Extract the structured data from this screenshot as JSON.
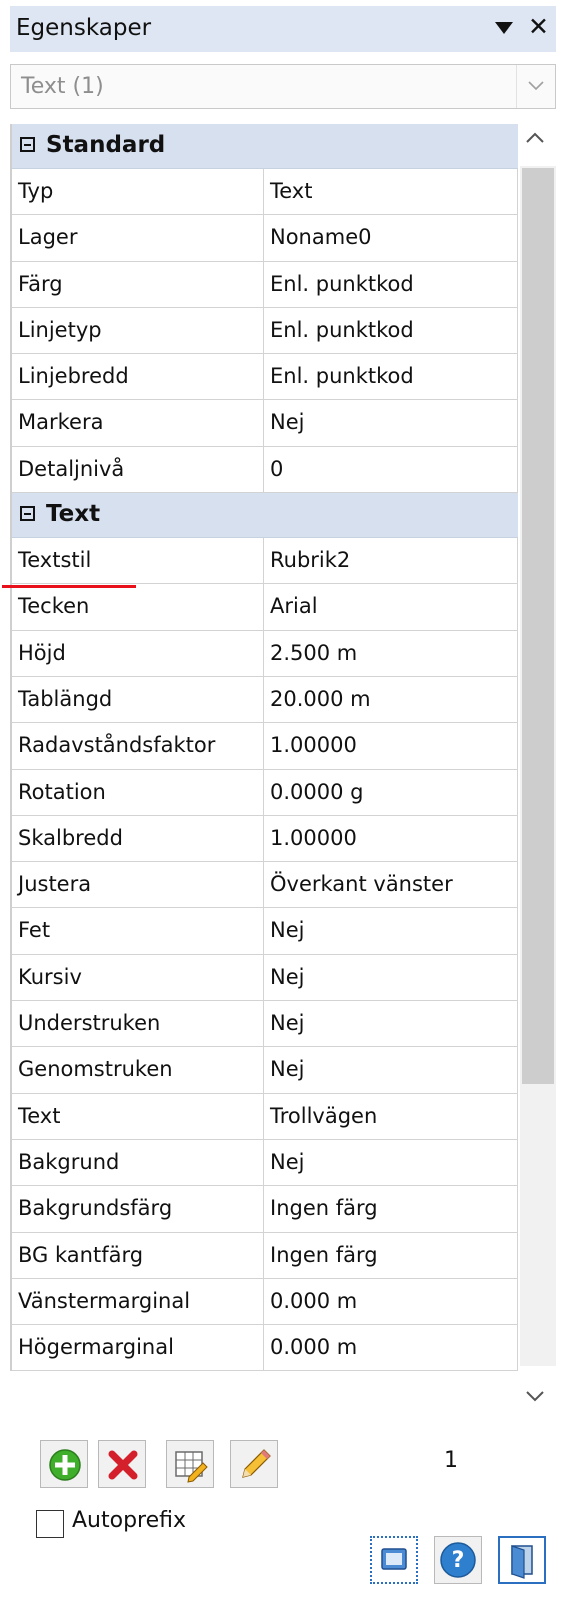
{
  "panel": {
    "title": "Egenskaper",
    "pin_icon": "dropdown-arrow-icon",
    "close_glyph": "✕"
  },
  "selector": {
    "value": "Text (1)"
  },
  "sections": [
    {
      "label": "Standard",
      "rows": [
        {
          "name": "Typ",
          "value": "Text"
        },
        {
          "name": "Lager",
          "value": "Noname0"
        },
        {
          "name": "Färg",
          "value": "Enl. punktkod"
        },
        {
          "name": "Linjetyp",
          "value": "Enl. punktkod"
        },
        {
          "name": "Linjebredd",
          "value": "Enl. punktkod"
        },
        {
          "name": "Markera",
          "value": "Nej"
        },
        {
          "name": "Detaljnivå",
          "value": "0"
        }
      ]
    },
    {
      "label": "Text",
      "rows": [
        {
          "name": "Textstil",
          "value": "Rubrik2"
        },
        {
          "name": "Tecken",
          "value": "Arial"
        },
        {
          "name": "Höjd",
          "value": "2.500 m"
        },
        {
          "name": "Tablängd",
          "value": "20.000 m"
        },
        {
          "name": "Radavståndsfaktor",
          "value": "1.00000"
        },
        {
          "name": "Rotation",
          "value": "0.0000 g"
        },
        {
          "name": "Skalbredd",
          "value": "1.00000"
        },
        {
          "name": "Justera",
          "value": "Överkant vänster"
        },
        {
          "name": "Fet",
          "value": "Nej"
        },
        {
          "name": "Kursiv",
          "value": "Nej"
        },
        {
          "name": "Understruken",
          "value": "Nej"
        },
        {
          "name": "Genomstruken",
          "value": "Nej"
        },
        {
          "name": "Text",
          "value": "Trollvägen"
        },
        {
          "name": "Bakgrund",
          "value": "Nej"
        },
        {
          "name": "Bakgrundsfärg",
          "value": "Ingen färg"
        },
        {
          "name": "BG kantfärg",
          "value": "Ingen färg"
        },
        {
          "name": "Vänstermarginal",
          "value": "0.000 m"
        },
        {
          "name": "Högermarginal",
          "value": "0.000 m"
        }
      ]
    }
  ],
  "toolbar": {
    "buttons": [
      "add-icon",
      "delete-icon",
      "edit-table-icon",
      "pencil-icon"
    ],
    "counter": "1"
  },
  "autoprefix": {
    "label": "Autoprefix",
    "checked": false
  },
  "bottom_buttons": [
    "select-frame-icon",
    "help-icon",
    "exit-door-icon"
  ],
  "colors": {
    "header_bg": "#dde6f2",
    "section_bg": "#d6e0ee",
    "annotation_red": "#e8101a",
    "add_green": "#3fae2a",
    "delete_red": "#d4202a",
    "help_blue": "#2f7fcf"
  }
}
